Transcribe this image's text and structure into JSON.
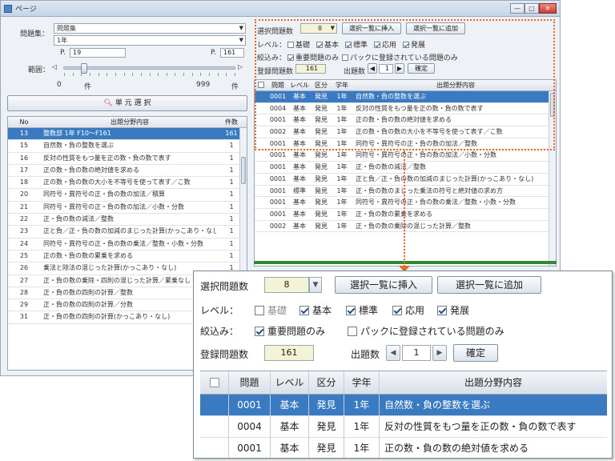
{
  "window": {
    "title": "ページ"
  },
  "left": {
    "field_label": "問題集：",
    "field_value": "問題集",
    "field2_value": "1年",
    "from_prefix": "P.",
    "from_value": "19",
    "to_prefix": "P.",
    "to_value": "161",
    "page_label": "範囲：",
    "slider_min": "0",
    "slider_min_unit": "件",
    "slider_max": "999",
    "slider_max_unit": "件",
    "slider_position": 0.1,
    "list_button": "単 元 選 択",
    "columns": [
      "No",
      "出題分野内容",
      "件数"
    ],
    "rows": [
      {
        "no": "13",
        "content": "整数部  1年 F10〜F161",
        "count": "161",
        "selected": true
      },
      {
        "no": "15",
        "content": "自然数・負の整数を選ぶ",
        "count": "1"
      },
      {
        "no": "16",
        "content": "反対の性質をもつ量を正の数・負の数で表す",
        "count": "1"
      },
      {
        "no": "17",
        "content": "正の数・負の数の絶対値を求める",
        "count": "1"
      },
      {
        "no": "18",
        "content": "正の数・負の数の大小を不等号を使って表す／こ数",
        "count": "1"
      },
      {
        "no": "20",
        "content": "同符号・異符号の正・負の数の加法／積算",
        "count": "1"
      },
      {
        "no": "21",
        "content": "同符号・異符号の正・負の数の加法／小数・分数",
        "count": "1"
      },
      {
        "no": "22",
        "content": "正・負の数の減法／整数",
        "count": "1"
      },
      {
        "no": "23",
        "content": "正と負／正・負の数の加減のまじった計算(かっこあり・なし)",
        "count": "1"
      },
      {
        "no": "24",
        "content": "同符号・異符号の正・負の数の乗法／整数・小数・分数",
        "count": "1"
      },
      {
        "no": "25",
        "content": "正の数・負の数の累乗を求める",
        "count": "1"
      },
      {
        "no": "26",
        "content": "乗法と除法の混じった計算(かっこあり・なし)",
        "count": "1"
      },
      {
        "no": "27",
        "content": "正・負の数の乗除・四則の混じった計算／累乗なし",
        "count": "1"
      },
      {
        "no": "28",
        "content": "正・負の数の四則の計算／整数",
        "count": "1"
      },
      {
        "no": "29",
        "content": "正・負の数の四則の計算／分数",
        "count": "1"
      },
      {
        "no": "31",
        "content": "正・負の数の四則の計算(かっこあり・なし)",
        "count": "1"
      }
    ]
  },
  "top_right": {
    "select_label": "選択問題数",
    "select_value": "8",
    "insert_button": "選択一覧に挿入",
    "append_button": "選択一覧に追加",
    "level_label": "レベル：",
    "levels": [
      {
        "label": "基礎",
        "checked": false
      },
      {
        "label": "基本",
        "checked": true
      },
      {
        "label": "標準",
        "checked": true
      },
      {
        "label": "応用",
        "checked": true
      },
      {
        "label": "発展",
        "checked": true
      }
    ],
    "filter_label": "絞込み：",
    "filter_important": "重要問題のみ",
    "filter_pack": "パックに登録されている問題のみ",
    "registered_label": "登録問題数",
    "registered_value": "161",
    "count_label": "出題数",
    "count_value": "1",
    "confirm_button": "確定",
    "columns": [
      "問題",
      "レベル",
      "区分",
      "学年",
      "出題分野内容"
    ],
    "rows": [
      {
        "q": "0001",
        "level": "基本",
        "kind": "発見",
        "grade": "1年",
        "content": "自然数・負の整数を選ぶ",
        "selected": true
      },
      {
        "q": "0004",
        "level": "基本",
        "kind": "発見",
        "grade": "1年",
        "content": "反対の性質をもつ量を正の数・負の数で表す"
      },
      {
        "q": "0001",
        "level": "基本",
        "kind": "発見",
        "grade": "1年",
        "content": "正の数・負の数の絶対値を求める"
      },
      {
        "q": "0002",
        "level": "基本",
        "kind": "発見",
        "grade": "1年",
        "content": "正の数・負の数の大小を不等号を使って表す／こ数"
      },
      {
        "q": "0001",
        "level": "基本",
        "kind": "発見",
        "grade": "1年",
        "content": "同符号・異符号の正・負の数の加法／整数"
      },
      {
        "q": "0001",
        "level": "基本",
        "kind": "発見",
        "grade": "1年",
        "content": "同符号・異符号の正・負の数の加法／小数・分数"
      },
      {
        "q": "0001",
        "level": "基本",
        "kind": "発見",
        "grade": "1年",
        "content": "正・負の数の減法／整数"
      },
      {
        "q": "0001",
        "level": "基本",
        "kind": "発見",
        "grade": "1年",
        "content": "正と負／正・負の数の加減のまじった計算(かっこあり・なし)"
      },
      {
        "q": "0001",
        "level": "標準",
        "kind": "発見",
        "grade": "1年",
        "content": "正・負の数のまじった乗法の符号と絶対値の求め方"
      },
      {
        "q": "0001",
        "level": "基本",
        "kind": "発見",
        "grade": "1年",
        "content": "同符号・異符号の正・負の数の乗法／整数・小数・分数"
      },
      {
        "q": "0001",
        "level": "基本",
        "kind": "発見",
        "grade": "1年",
        "content": "正・負の数の累乗を求める"
      },
      {
        "q": "0002",
        "level": "基本",
        "kind": "発見",
        "grade": "1年",
        "content": "正・負の数の乗除の混じった計算／整数"
      }
    ]
  },
  "zoom": {
    "select_label": "選択問題数",
    "select_value": "8",
    "insert_button": "選択一覧に挿入",
    "append_button": "選択一覧に追加",
    "level_label": "レベル：",
    "filter_label": "絞込み：",
    "filter_important": "重要問題のみ",
    "filter_pack": "パックに登録されている問題のみ",
    "registered_label": "登録問題数",
    "registered_value": "161",
    "count_label": "出題数",
    "count_value": "1",
    "confirm_button": "確定",
    "columns": [
      "問題",
      "レベル",
      "区分",
      "学年",
      "出題分野内容"
    ],
    "rows": [
      {
        "q": "0001",
        "level": "基本",
        "kind": "発見",
        "grade": "1年",
        "content": "自然数・負の整数を選ぶ",
        "selected": true
      },
      {
        "q": "0004",
        "level": "基本",
        "kind": "発見",
        "grade": "1年",
        "content": "反対の性質をもつ量を正の数・負の数で表す"
      },
      {
        "q": "0001",
        "level": "基本",
        "kind": "発見",
        "grade": "1年",
        "content": "正の数・負の数の絶対値を求める"
      }
    ]
  },
  "colors": {
    "selection": "#3a7ac0",
    "callout": "#e56a2a",
    "accent_green": "#2f8a2f"
  }
}
